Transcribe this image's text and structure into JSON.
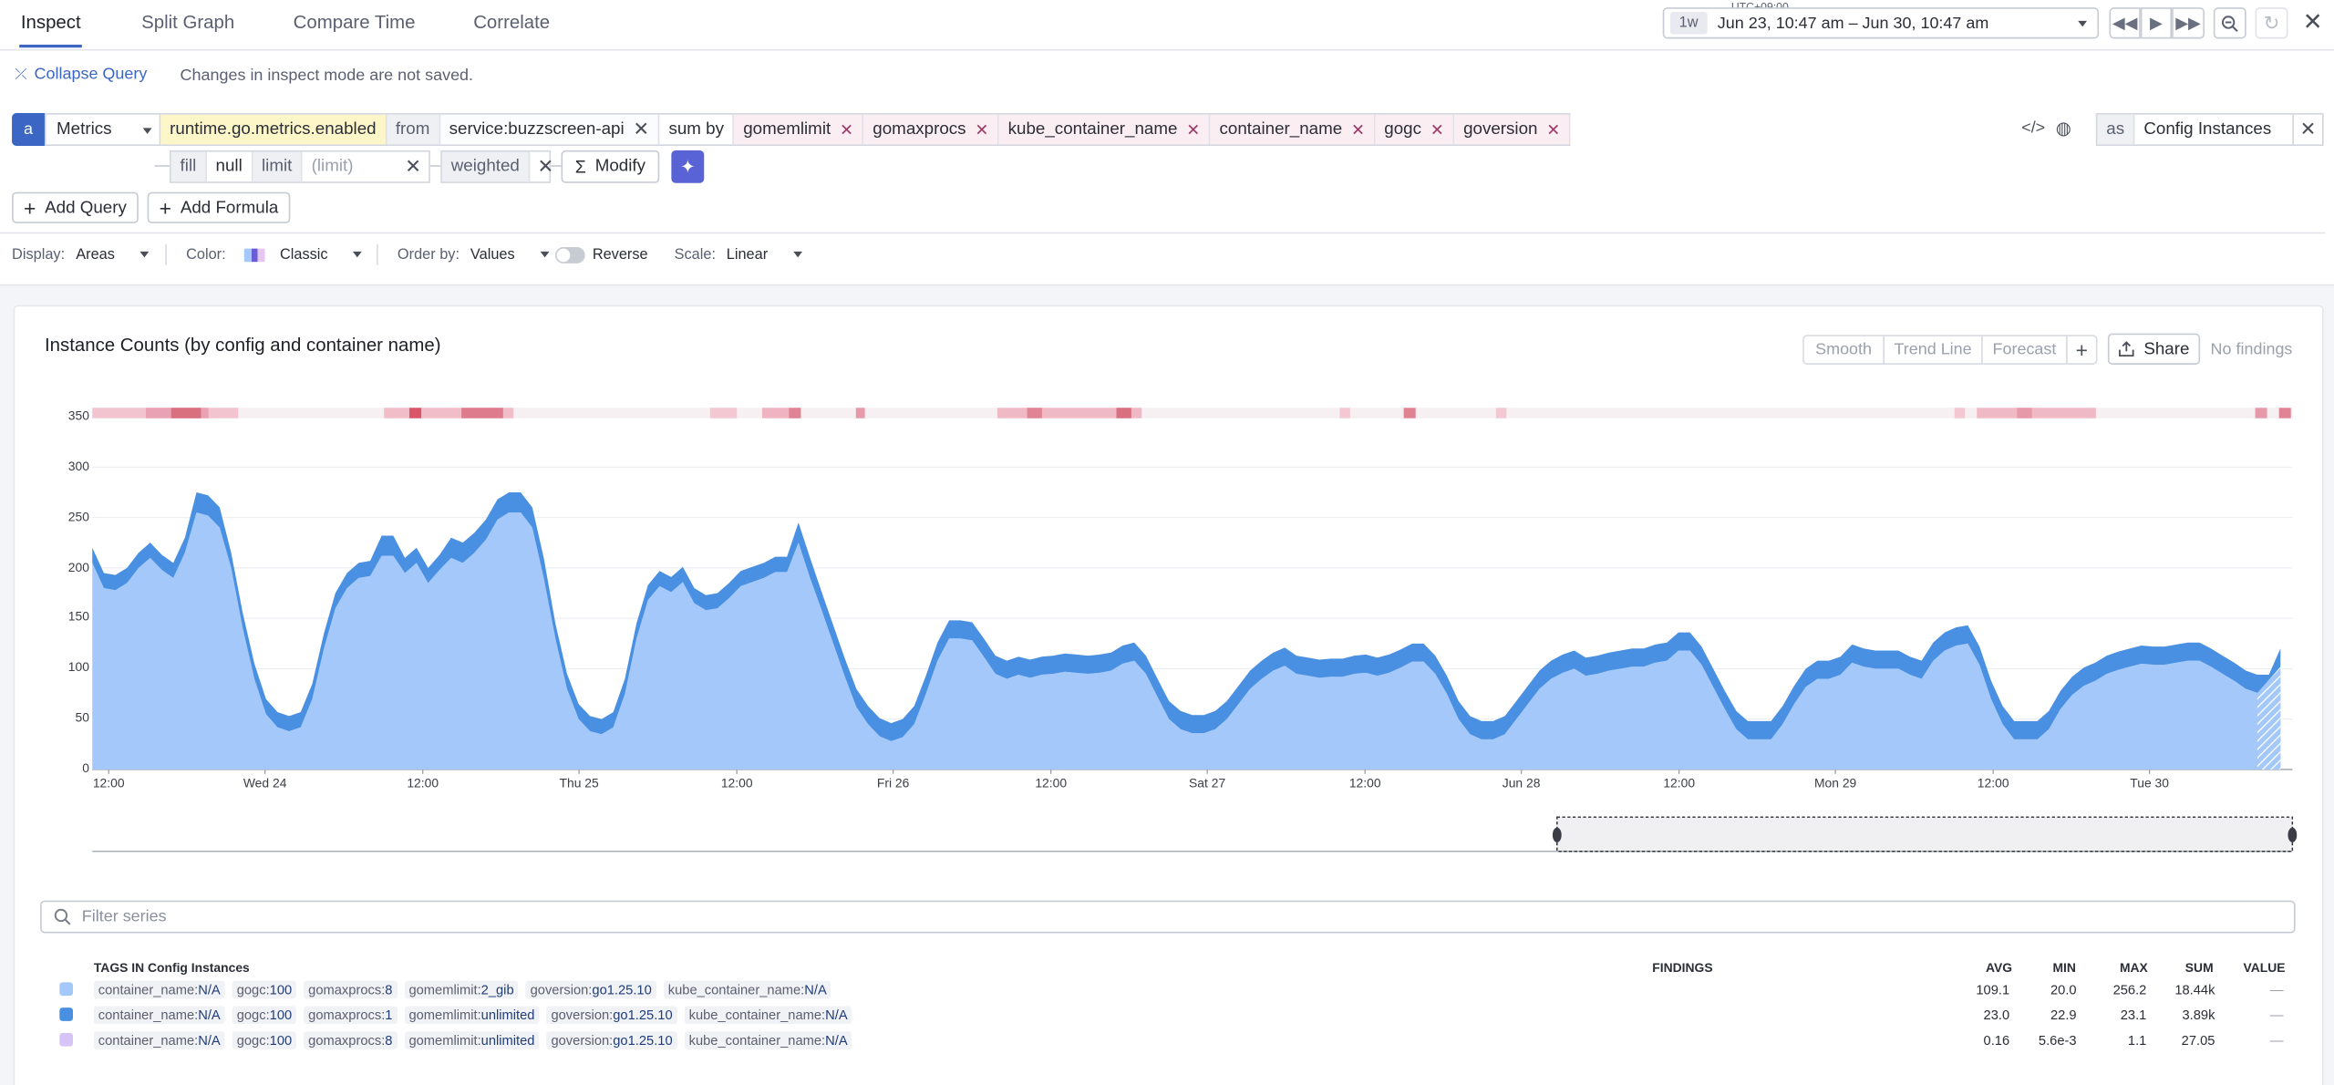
{
  "tabs": [
    {
      "label": "Inspect"
    },
    {
      "label": "Split Graph"
    },
    {
      "label": "Compare Time"
    },
    {
      "label": "Correlate"
    }
  ],
  "timepicker": {
    "timezone": "UTC+09:00",
    "preset": "1w",
    "range": "Jun 23, 10:47 am – Jun 30, 10:47 am"
  },
  "header": {
    "collapse_label": "Collapse Query",
    "notice": "Changes in inspect mode are not saved."
  },
  "query": {
    "letter": "a",
    "source": "Metrics",
    "metric": "runtime.go.metrics.enabled",
    "from_label": "from",
    "from_value": "service:buzzscreen-api",
    "sumby_label": "sum by",
    "groups": [
      "gomemlimit",
      "gomaxprocs",
      "kube_container_name",
      "container_name",
      "gogc",
      "goversion"
    ],
    "as_label": "as",
    "alias": "Config Instances",
    "fill_label": "fill",
    "fill_value": "null",
    "limit_label": "limit",
    "limit_placeholder": "(limit)",
    "weighted_label": "weighted",
    "modify_label": "Modify"
  },
  "actions": {
    "add_query": "Add Query",
    "add_formula": "Add Formula"
  },
  "options": {
    "display_label": "Display:",
    "display_value": "Areas",
    "color_label": "Color:",
    "color_value": "Classic",
    "order_label": "Order by:",
    "order_value": "Values",
    "reverse_label": "Reverse",
    "scale_label": "Scale:",
    "scale_value": "Linear"
  },
  "graph": {
    "title": "Instance Counts (by config and container name)",
    "smooth": "Smooth",
    "trend": "Trend Line",
    "forecast": "Forecast",
    "share": "Share",
    "findings": "No findings"
  },
  "chart_data": {
    "type": "area",
    "stacked": true,
    "ylim": [
      0,
      350
    ],
    "yticks": [
      0,
      50,
      100,
      150,
      200,
      250,
      300,
      350
    ],
    "xtick_labels": [
      "12:00",
      "Wed 24",
      "12:00",
      "Thu 25",
      "12:00",
      "Fri 26",
      "12:00",
      "Sat 27",
      "12:00",
      "Jun 28",
      "12:00",
      "Mon 29",
      "12:00",
      "Tue 30"
    ],
    "series": [
      {
        "color": "#a4c8fa",
        "values": [
          205,
          180,
          178,
          185,
          200,
          210,
          198,
          190,
          215,
          255,
          252,
          240,
          200,
          140,
          90,
          55,
          42,
          38,
          42,
          70,
          120,
          160,
          180,
          190,
          192,
          212,
          212,
          195,
          205,
          185,
          198,
          210,
          205,
          215,
          228,
          248,
          255,
          255,
          240,
          190,
          130,
          80,
          50,
          38,
          35,
          42,
          75,
          130,
          168,
          182,
          176,
          186,
          165,
          158,
          160,
          170,
          182,
          186,
          190,
          196,
          196,
          225,
          190,
          158,
          125,
          92,
          62,
          45,
          33,
          28,
          32,
          45,
          75,
          108,
          130,
          130,
          128,
          112,
          95,
          90,
          94,
          91,
          94,
          95,
          97,
          96,
          95,
          96,
          98,
          105,
          108,
          95,
          72,
          50,
          40,
          36,
          36,
          40,
          50,
          65,
          80,
          90,
          98,
          103,
          95,
          93,
          91,
          92,
          92,
          95,
          96,
          93,
          96,
          101,
          107,
          107,
          95,
          75,
          50,
          35,
          30,
          30,
          35,
          50,
          65,
          80,
          90,
          96,
          100,
          93,
          95,
          98,
          100,
          102,
          102,
          106,
          108,
          118,
          118,
          104,
          82,
          60,
          40,
          30,
          30,
          30,
          45,
          65,
          82,
          90,
          90,
          94,
          106,
          102,
          100,
          100,
          100,
          94,
          90,
          108,
          118,
          123,
          125,
          104,
          70,
          45,
          30,
          30,
          30,
          40,
          60,
          74,
          83,
          88,
          95,
          99,
          102,
          105,
          104,
          104,
          106,
          108,
          108,
          102,
          95,
          88,
          80,
          76,
          76,
          102
        ]
      },
      {
        "color": "#4a90e2",
        "values": [
          15,
          15,
          15,
          15,
          15,
          15,
          15,
          15,
          15,
          20,
          20,
          20,
          15,
          15,
          15,
          15,
          15,
          15,
          15,
          15,
          15,
          15,
          15,
          15,
          15,
          20,
          20,
          15,
          15,
          15,
          15,
          20,
          20,
          20,
          20,
          20,
          20,
          20,
          20,
          20,
          15,
          15,
          15,
          15,
          15,
          15,
          15,
          15,
          15,
          15,
          15,
          15,
          15,
          15,
          15,
          15,
          15,
          15,
          15,
          15,
          15,
          20,
          20,
          18,
          18,
          18,
          18,
          18,
          18,
          18,
          18,
          18,
          18,
          18,
          18,
          18,
          18,
          18,
          18,
          18,
          18,
          18,
          18,
          18,
          18,
          18,
          18,
          18,
          18,
          18,
          18,
          18,
          18,
          18,
          18,
          18,
          18,
          18,
          18,
          18,
          18,
          18,
          18,
          18,
          18,
          18,
          18,
          18,
          18,
          18,
          18,
          18,
          18,
          18,
          18,
          18,
          18,
          18,
          18,
          18,
          18,
          18,
          18,
          18,
          18,
          18,
          18,
          18,
          18,
          18,
          18,
          18,
          18,
          18,
          18,
          18,
          18,
          18,
          18,
          18,
          18,
          18,
          18,
          18,
          18,
          18,
          18,
          18,
          18,
          18,
          18,
          18,
          18,
          18,
          18,
          18,
          18,
          18,
          18,
          18,
          18,
          18,
          18,
          18,
          18,
          18,
          18,
          18,
          18,
          18,
          18,
          18,
          18,
          18,
          18,
          18,
          18,
          18,
          18,
          18,
          18,
          18,
          18,
          18,
          18,
          18,
          18,
          18,
          18,
          18,
          18,
          18
        ]
      }
    ]
  },
  "filter_placeholder": "Filter series",
  "legend": {
    "tags_header": "TAGS IN Config Instances",
    "findings_header": "FINDINGS",
    "columns": [
      "AVG",
      "MIN",
      "MAX",
      "SUM",
      "VALUE"
    ],
    "rows": [
      {
        "color": "#a4c8fa",
        "tags": [
          [
            "container_name:",
            "N/A"
          ],
          [
            "gogc:",
            "100"
          ],
          [
            "gomaxprocs:",
            "8"
          ],
          [
            "gomemlimit:",
            "2_gib"
          ],
          [
            "goversion:",
            "go1.25.10"
          ],
          [
            "kube_container_name:",
            "N/A"
          ]
        ],
        "avg": "109.1",
        "min": "20.0",
        "max": "256.2",
        "sum": "18.44k",
        "value": "—"
      },
      {
        "color": "#4a90e2",
        "tags": [
          [
            "container_name:",
            "N/A"
          ],
          [
            "gogc:",
            "100"
          ],
          [
            "gomaxprocs:",
            "1"
          ],
          [
            "gomemlimit:",
            "unlimited"
          ],
          [
            "goversion:",
            "go1.25.10"
          ],
          [
            "kube_container_name:",
            "N/A"
          ]
        ],
        "avg": "23.0",
        "min": "22.9",
        "max": "23.1",
        "sum": "3.89k",
        "value": "—"
      },
      {
        "color": "#d6c4f7",
        "tags": [
          [
            "container_name:",
            "N/A"
          ],
          [
            "gogc:",
            "100"
          ],
          [
            "gomaxprocs:",
            "8"
          ],
          [
            "gomemlimit:",
            "unlimited"
          ],
          [
            "goversion:",
            "go1.25.10"
          ],
          [
            "kube_container_name:",
            "N/A"
          ]
        ],
        "avg": "0.16",
        "min": "5.6e-3",
        "max": "1.1",
        "sum": "27.05",
        "value": "—"
      }
    ]
  }
}
